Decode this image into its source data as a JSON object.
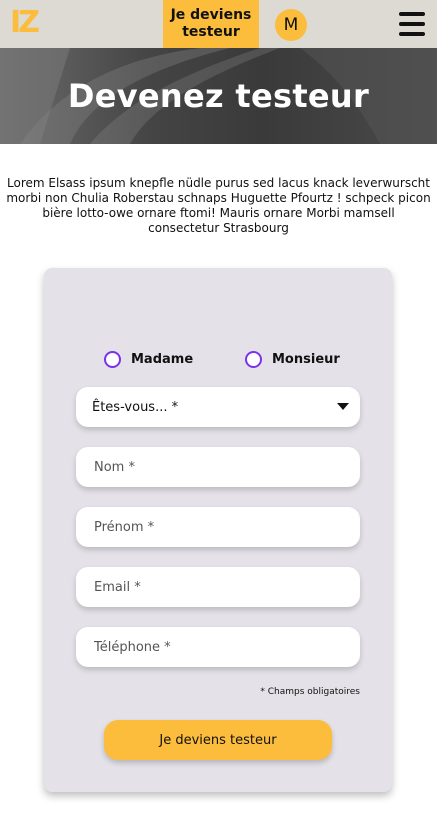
{
  "header": {
    "logo_text": "IZ",
    "cta_label": "Je deviens\ntesteur",
    "avatar_initial": "M",
    "menu_icon": "hamburger-icon",
    "accent_color": "#fbbd3b"
  },
  "hero": {
    "title": "Devenez testeur"
  },
  "intro": {
    "text": "Lorem Elsass ipsum knepfle nüdle purus sed lacus knack leverwurscht morbi non Chulia Roberstau schnaps Huguette Pfourtz ! schpeck picon bière lotto-owe ornare ftomi! Mauris ornare Morbi mamsell consectetur Strasbourg"
  },
  "form": {
    "radio_options": [
      "Madame",
      "Monsieur"
    ],
    "status_select": {
      "value": "Êtes-vous... *"
    },
    "fields": {
      "nom_placeholder": "Nom *",
      "prenom_placeholder": "Prénom *",
      "email_placeholder": "Email *",
      "telephone_placeholder": "Téléphone *"
    },
    "required_note": "* Champs obligatoires",
    "submit_label": "Je deviens testeur",
    "radio_color": "#7a33e8"
  }
}
